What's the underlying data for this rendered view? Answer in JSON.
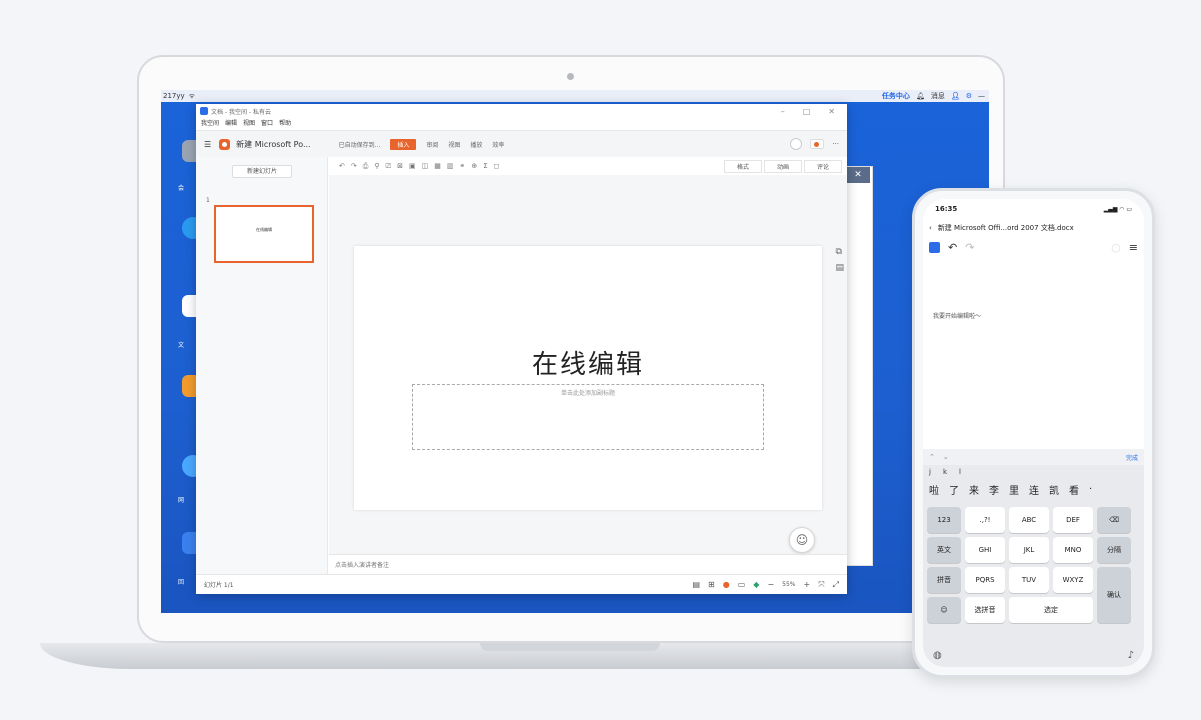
{
  "desktop": {
    "taskbar_left": "217yy",
    "taskbar_right": [
      "任务中心",
      "消息"
    ],
    "icons": [
      {
        "label": "会",
        "color": "#9aa4b2"
      },
      {
        "label": "",
        "color": "#2a9bf0"
      },
      {
        "label": "文",
        "color": "#ffffff"
      },
      {
        "label": "",
        "color": "#f29b2e"
      },
      {
        "label": "网",
        "color": "#4aa8ff"
      },
      {
        "label": "回",
        "color": "#3b80f0"
      }
    ]
  },
  "window": {
    "title": "文档 - 我空间 - 私有云",
    "menu": [
      "我空间",
      "编辑",
      "视图",
      "窗口",
      "帮助"
    ],
    "doc_name": "新建 Microsoft Po...",
    "autosave": "已自动保存到...",
    "tabs": [
      "插入",
      "审阅",
      "视图",
      "播放",
      "效率"
    ],
    "active_tab": "插入",
    "toolbar_pills": [
      "格式",
      "动画",
      "评论"
    ],
    "new_slide": "新建幻灯片",
    "thumb_number": "1",
    "thumb_text": "在线编辑",
    "slide_title": "在线编辑",
    "subtitle_placeholder": "单击此处添加副标题",
    "notes_placeholder": "点击插入演讲者备注",
    "status_left": "幻灯片 1/1",
    "zoom": "55%"
  },
  "phone": {
    "time": "16:35",
    "title": "新建 Microsoft Offi...ord 2007 文档.docx",
    "doc_text": "我要开始编辑啦～",
    "keyboard_done": "完成",
    "pinyin": [
      "j",
      "k",
      "l"
    ],
    "candidates": [
      "啦",
      "了",
      "来",
      "李",
      "里",
      "连",
      "凯",
      "看",
      "·"
    ],
    "keys": [
      "123",
      ".,?!",
      "ABC",
      "DEF",
      "⌫",
      "英文",
      "GHI",
      "JKL",
      "MNO",
      "分隔",
      "拼音",
      "PQRS",
      "TUV",
      "WXYZ",
      "确认",
      "☺",
      "选拼音",
      "选定"
    ]
  },
  "colors": {
    "accent": "#e8642c",
    "desktop_blue": "#1a63d9",
    "link_blue": "#2b6de8"
  }
}
